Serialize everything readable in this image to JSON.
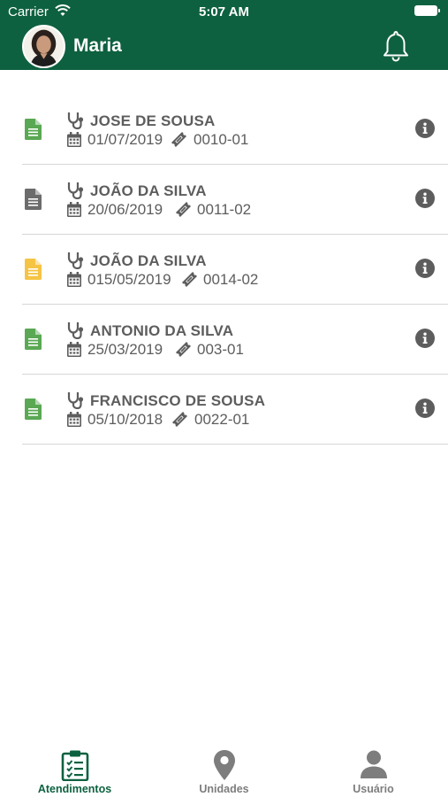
{
  "status_bar": {
    "carrier": "Carrier",
    "time": "5:07 AM"
  },
  "header": {
    "user_name": "Maria",
    "accent_color": "#0e6140"
  },
  "appointments": [
    {
      "name": "JOSE DE SOUSA",
      "date": "01/07/2019",
      "code": "0010-01",
      "doc_color": "#5ba854",
      "doc_icon": "document-icon-green"
    },
    {
      "name": "JOÃO DA SILVA",
      "date": "20/06/2019",
      "code": "0011-02",
      "doc_color": "#6c6c6c",
      "doc_icon": "document-icon-gray"
    },
    {
      "name": "JOÃO DA SILVA",
      "date": "015/05/2019",
      "code": "0014-02",
      "doc_color": "#f6c445",
      "doc_icon": "document-icon-yellow"
    },
    {
      "name": "ANTONIO DA SILVA",
      "date": "25/03/2019",
      "code": "003-01",
      "doc_color": "#5ba854",
      "doc_icon": "document-icon-green"
    },
    {
      "name": "FRANCISCO DE SOUSA",
      "date": "05/10/2018",
      "code": "0022-01",
      "doc_color": "#5ba854",
      "doc_icon": "document-icon-green"
    }
  ],
  "tabs": [
    {
      "label": "Atendimentos",
      "icon": "clipboard-check-icon",
      "active": true
    },
    {
      "label": "Unidades",
      "icon": "map-pin-icon",
      "active": false
    },
    {
      "label": "Usuário",
      "icon": "user-icon",
      "active": false
    }
  ]
}
